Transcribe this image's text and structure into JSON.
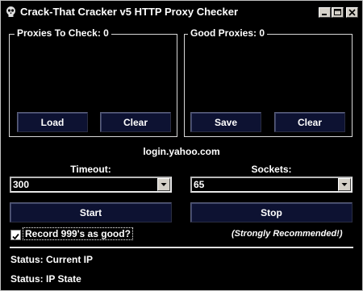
{
  "window": {
    "title": "Crack-That Cracker v5 HTTP Proxy Checker",
    "icon": "skull-icon",
    "controls": [
      "minimize-icon",
      "maximize-icon",
      "close-icon"
    ]
  },
  "proxies_panel": {
    "legend": "Proxies To Check: 0",
    "load_label": "Load",
    "clear_label": "Clear"
  },
  "good_panel": {
    "legend": "Good Proxies: 0",
    "save_label": "Save",
    "clear_label": "Clear"
  },
  "target_host": "login.yahoo.com",
  "timeout": {
    "label": "Timeout:",
    "value": "300"
  },
  "sockets": {
    "label": "Sockets:",
    "value": "65"
  },
  "actions": {
    "start_label": "Start",
    "stop_label": "Stop"
  },
  "record_option": {
    "label": "Record 999's as good?",
    "checked": true,
    "note": "(Strongly Recommended!)"
  },
  "status": {
    "line1": "Status: Current IP",
    "line2": "Status: IP State"
  },
  "colors": {
    "background": "#000000",
    "button": "#0d1232",
    "text": "#ffffff"
  }
}
